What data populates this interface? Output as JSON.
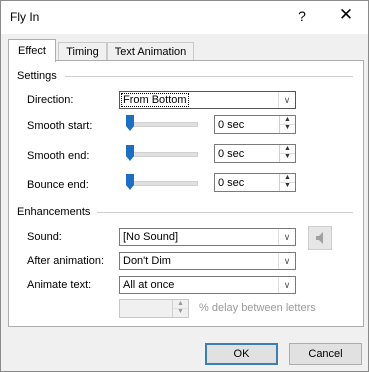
{
  "window": {
    "title": "Fly In",
    "help_label": "?",
    "close_label": "✕"
  },
  "tabs": [
    {
      "label": "Effect",
      "active": true
    },
    {
      "label": "Timing",
      "active": false
    },
    {
      "label": "Text Animation",
      "active": false
    }
  ],
  "settings": {
    "group_label": "Settings",
    "direction": {
      "label": "Direction:",
      "value": "From Bottom"
    },
    "smooth_start": {
      "label": "Smooth start:",
      "value": "0 sec",
      "level": 0
    },
    "smooth_end": {
      "label": "Smooth end:",
      "value": "0 sec",
      "level": 0
    },
    "bounce_end": {
      "label": "Bounce end:",
      "value": "0 sec",
      "level": 0
    }
  },
  "enhancements": {
    "group_label": "Enhancements",
    "sound": {
      "label": "Sound:",
      "value": "[No Sound]"
    },
    "after_animation": {
      "label": "After animation:",
      "value": "Don't Dim"
    },
    "animate_text": {
      "label": "Animate text:",
      "value": "All at once"
    },
    "delay": {
      "value": "",
      "suffix": "% delay between letters"
    }
  },
  "buttons": {
    "ok": "OK",
    "cancel": "Cancel"
  },
  "colors": {
    "accent": "#3c7fb1",
    "slider_thumb": "#1e6fc3"
  }
}
